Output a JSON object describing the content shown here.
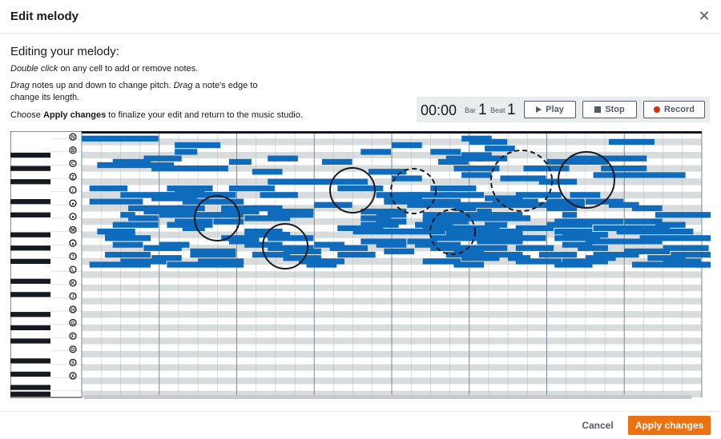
{
  "modal": {
    "title": "Edit melody",
    "close_icon": "close-icon"
  },
  "intro": {
    "heading": "Editing your melody:",
    "line1": {
      "em": "Double click",
      "rest": " on any cell to add or remove notes."
    },
    "line2": {
      "em1": "Drag",
      "mid": " notes up and down to change pitch. ",
      "em2": "Drag",
      "rest": " a note's edge to change its length."
    },
    "line3": {
      "pre": "Choose ",
      "strong": "Apply changes",
      "rest": " to finalize your edit and return to the music studio."
    }
  },
  "transport": {
    "time": "00:00",
    "bar_label": "Bar",
    "bar_value": "1",
    "beat_label": "Beat",
    "beat_value": "1",
    "play": "Play",
    "stop": "Stop",
    "record": "Record"
  },
  "pitch_labels": [
    "N",
    "B",
    "C",
    "Z",
    "/",
    "●",
    "●",
    "M",
    "●",
    "?",
    "L",
    "K",
    "J",
    "H",
    "G",
    "F",
    "D",
    "S",
    "A"
  ],
  "colors": {
    "note": "#0f6cbd",
    "accent": "#ec7211",
    "record": "#d13212",
    "row_light": "#ffffff",
    "row_dark": "#d8dcdc"
  },
  "notes": [
    [
      1,
      0,
      1
    ],
    [
      1,
      4.9,
      0.4
    ],
    [
      2,
      5.0,
      0.5
    ],
    [
      2,
      6.8,
      0.6
    ],
    [
      3,
      1.2,
      0.6
    ],
    [
      3,
      4.0,
      0.4
    ],
    [
      4,
      5.2,
      0.4
    ],
    [
      5,
      1.2,
      0.3
    ],
    [
      5,
      3.6,
      0.4
    ],
    [
      5,
      4.5,
      0.4
    ],
    [
      6,
      4.9,
      0.4
    ],
    [
      7,
      0.8,
      0.5
    ],
    [
      7,
      2.4,
      0.4
    ],
    [
      7,
      4.7,
      0.5
    ],
    [
      7,
      5.1,
      0.4
    ],
    [
      7,
      6.3,
      1.0
    ],
    [
      8,
      0.4,
      0.5
    ],
    [
      8,
      1.9,
      0.3
    ],
    [
      8,
      3.1,
      0.4
    ],
    [
      8,
      4.6,
      0.4
    ],
    [
      8,
      6.0,
      0.8
    ],
    [
      9,
      0.2,
      1.0
    ],
    [
      10,
      0.9,
      1.0
    ],
    [
      10,
      4.8,
      0.6
    ],
    [
      10,
      5.7,
      0.6
    ],
    [
      10,
      6.7,
      0.6
    ],
    [
      11,
      2.2,
      0.4
    ],
    [
      11,
      3.7,
      0.5
    ],
    [
      12,
      4.9,
      0.4
    ],
    [
      12,
      6.6,
      1.2
    ],
    [
      13,
      4.0,
      0.4
    ],
    [
      13,
      5.4,
      0.6
    ],
    [
      14,
      2.4,
      1.0
    ],
    [
      14,
      3.3,
      0.4
    ],
    [
      14,
      5.9,
      0.5
    ],
    [
      16,
      0.1,
      0.5
    ],
    [
      16,
      1.1,
      0.6
    ],
    [
      16,
      1.9,
      0.6
    ],
    [
      16,
      3.3,
      0.6
    ],
    [
      16,
      4.5,
      0.6
    ],
    [
      17,
      1.2,
      0.4
    ],
    [
      18,
      0.5,
      1.0
    ],
    [
      18,
      1.0,
      1.0
    ],
    [
      18,
      1.5,
      0.5
    ],
    [
      18,
      2.3,
      0.5
    ],
    [
      18,
      3.8,
      0.6
    ],
    [
      18,
      4.2,
      0.6
    ],
    [
      18,
      4.7,
      0.5
    ],
    [
      18,
      5.6,
      0.6
    ],
    [
      18,
      6.3,
      0.4
    ],
    [
      19,
      0.9,
      0.6
    ],
    [
      19,
      3.9,
      0.5
    ],
    [
      19,
      5.2,
      0.5
    ],
    [
      20,
      0.1,
      0.7
    ],
    [
      20,
      1.3,
      0.8
    ],
    [
      20,
      3.9,
      1.0
    ],
    [
      20,
      5.3,
      0.6
    ],
    [
      20,
      6.0,
      0.5
    ],
    [
      20,
      6.5,
      0.5
    ],
    [
      21,
      3.0,
      0.5
    ],
    [
      21,
      4.2,
      1.6
    ],
    [
      21,
      5.3,
      1.1
    ],
    [
      21,
      6.2,
      0.3
    ],
    [
      21,
      6.8,
      0.4
    ],
    [
      22,
      0.6,
      1.0
    ],
    [
      22,
      1.2,
      0.3
    ],
    [
      22,
      1.8,
      0.8
    ],
    [
      22,
      2.2,
      0.3
    ],
    [
      22,
      4.8,
      0.3
    ],
    [
      22,
      6.0,
      0.4
    ],
    [
      22,
      7.1,
      0.4
    ],
    [
      23,
      0.8,
      0.7
    ],
    [
      23,
      1.8,
      0.5
    ],
    [
      23,
      2.4,
      0.6
    ],
    [
      23,
      3.6,
      0.6
    ],
    [
      23,
      5.1,
      0.2
    ],
    [
      24,
      0.5,
      0.2
    ],
    [
      24,
      1.0,
      0.8
    ],
    [
      24,
      1.7,
      0.4
    ],
    [
      24,
      2.4,
      0.6
    ],
    [
      24,
      3.8,
      0.4
    ],
    [
      24,
      4.4,
      1.0
    ],
    [
      24,
      5.3,
      0.4
    ],
    [
      24,
      6.2,
      0.2
    ],
    [
      24,
      7.4,
      1.0
    ],
    [
      25,
      0.6,
      0.4
    ],
    [
      25,
      2.1,
      0.6
    ],
    [
      25,
      3.6,
      0.4
    ],
    [
      25,
      4.4,
      1.0
    ],
    [
      25,
      5.3,
      0.5
    ],
    [
      26,
      1.2,
      0.5
    ],
    [
      26,
      1.7,
      0.4
    ],
    [
      26,
      3.8,
      0.4
    ],
    [
      26,
      4.4,
      0.6
    ],
    [
      26,
      6.1,
      0.4
    ],
    [
      26,
      6.4,
      0.6
    ],
    [
      26,
      7.0,
      0.5
    ],
    [
      27,
      0.4,
      0.6
    ],
    [
      27,
      1.1,
      0.6
    ],
    [
      27,
      3.6,
      0.5
    ],
    [
      27,
      4.3,
      0.5
    ],
    [
      27,
      5.2,
      0.3
    ],
    [
      27,
      6.0,
      0.6
    ],
    [
      27,
      7.4,
      0.4
    ],
    [
      28,
      1.3,
      0.3
    ],
    [
      28,
      3.3,
      0.6
    ],
    [
      28,
      4.4,
      1.0
    ],
    [
      28,
      5.6,
      0.5
    ],
    [
      28,
      6.6,
      1.0
    ],
    [
      29,
      0.2,
      0.5
    ],
    [
      29,
      2.1,
      0.5
    ],
    [
      29,
      3.5,
      1.0
    ],
    [
      29,
      4.1,
      0.6
    ],
    [
      29,
      4.7,
      1.0
    ],
    [
      29,
      6.1,
      0.5
    ],
    [
      29,
      6.9,
      1.0
    ],
    [
      30,
      0.3,
      0.4
    ],
    [
      30,
      2.1,
      0.6
    ],
    [
      30,
      4.7,
      0.5
    ],
    [
      30,
      5.1,
      0.6
    ],
    [
      30,
      6.2,
      0.6
    ],
    [
      31,
      0.3,
      0.6
    ],
    [
      31,
      1.8,
      0.5
    ],
    [
      31,
      2.4,
      0.6
    ],
    [
      31,
      4.5,
      1.0
    ],
    [
      31,
      5.0,
      1.0
    ],
    [
      31,
      6.1,
      0.6
    ],
    [
      31,
      7.2,
      1.0
    ],
    [
      32,
      1.9,
      0.4
    ],
    [
      32,
      3.6,
      0.6
    ],
    [
      32,
      4.2,
      0.4
    ],
    [
      32,
      5.1,
      0.6
    ],
    [
      32,
      6.5,
      1.0
    ],
    [
      33,
      0.4,
      0.4
    ],
    [
      33,
      1.0,
      0.4
    ],
    [
      33,
      2.1,
      0.5
    ],
    [
      33,
      3.0,
      0.4
    ],
    [
      33,
      3.8,
      0.4
    ],
    [
      33,
      4.3,
      0.6
    ],
    [
      33,
      6.2,
      0.4
    ],
    [
      34,
      0.8,
      0.5
    ],
    [
      34,
      2.4,
      0.6
    ],
    [
      34,
      3.2,
      0.5
    ],
    [
      34,
      4.5,
      1.0
    ],
    [
      34,
      5.6,
      0.5
    ],
    [
      34,
      6.4,
      0.4
    ],
    [
      34,
      7.5,
      0.6
    ],
    [
      35,
      1.4,
      0.6
    ],
    [
      35,
      2.6,
      0.5
    ],
    [
      35,
      3.9,
      0.4
    ],
    [
      35,
      4.8,
      0.4
    ],
    [
      35,
      7.0,
      0.6
    ],
    [
      36,
      0.3,
      0.6
    ],
    [
      36,
      1.4,
      0.6
    ],
    [
      36,
      2.2,
      0.5
    ],
    [
      36,
      3.3,
      0.5
    ],
    [
      36,
      4.7,
      1.0
    ],
    [
      36,
      5.9,
      0.5
    ],
    [
      36,
      6.6,
      0.6
    ],
    [
      36,
      7.6,
      1.0
    ],
    [
      37,
      0.9,
      0.4
    ],
    [
      37,
      2.6,
      0.5
    ],
    [
      37,
      4.9,
      0.5
    ],
    [
      37,
      5.5,
      0.3
    ],
    [
      37,
      6.5,
      0.4
    ],
    [
      37,
      7.3,
      0.5
    ],
    [
      38,
      0.5,
      0.6
    ],
    [
      38,
      1.5,
      0.6
    ],
    [
      38,
      2.8,
      0.6
    ],
    [
      38,
      4.4,
      0.5
    ],
    [
      38,
      5.6,
      0.6
    ],
    [
      38,
      6.2,
      0.6
    ],
    [
      38,
      7.5,
      0.5
    ],
    [
      39,
      0.1,
      0.8
    ],
    [
      39,
      1.1,
      1.0
    ],
    [
      39,
      2.9,
      0.4
    ],
    [
      39,
      4.8,
      0.4
    ],
    [
      39,
      6.1,
      0.5
    ],
    [
      39,
      7.1,
      1.0
    ],
    [
      39,
      7.9,
      0.4
    ],
    [
      40,
      0.5,
      0.6
    ],
    [
      40,
      2.3,
      0.5
    ],
    [
      40,
      3.1,
      0.6
    ],
    [
      40,
      5.0,
      0.6
    ],
    [
      40,
      6.6,
      0.5
    ],
    [
      40,
      7.6,
      0.5
    ]
  ]
}
